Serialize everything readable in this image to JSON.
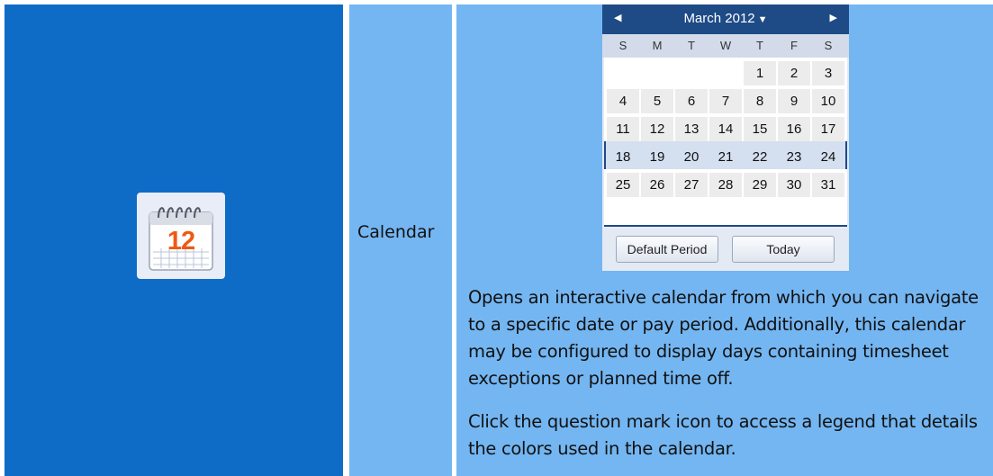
{
  "row": {
    "feature_name": "Calendar",
    "icon": {
      "name": "calendar-icon",
      "number": "12"
    },
    "calendar": {
      "month_label": "March 2012",
      "prev_icon": "triangle-left",
      "next_icon": "triangle-right",
      "dropdown_icon": "triangle-down",
      "weekdays": [
        "S",
        "M",
        "T",
        "W",
        "T",
        "F",
        "S"
      ],
      "weeks": [
        [
          "",
          "",
          "",
          "",
          "1",
          "2",
          "3"
        ],
        [
          "4",
          "5",
          "6",
          "7",
          "8",
          "9",
          "10"
        ],
        [
          "11",
          "12",
          "13",
          "14",
          "15",
          "16",
          "17"
        ],
        [
          "18",
          "19",
          "20",
          "21",
          "22",
          "23",
          "24"
        ],
        [
          "25",
          "26",
          "27",
          "28",
          "29",
          "30",
          "31"
        ]
      ],
      "highlighted_week_index": 3,
      "default_period_label": "Default Period",
      "today_label": "Today"
    },
    "description_1": "Opens an interactive calendar from which you can navigate to a specific date or pay period. Additionally, this calendar may be configured to display days containing timesheet exceptions or planned time off.",
    "description_2": "Click the question mark icon to access a legend that details the colors used in the calendar."
  },
  "colors": {
    "icon_cell_bg": "#0f6cc6",
    "text_cell_bg": "#74b6f2",
    "calendar_header": "#1e4a86",
    "icon_number": "#ee5a12"
  }
}
